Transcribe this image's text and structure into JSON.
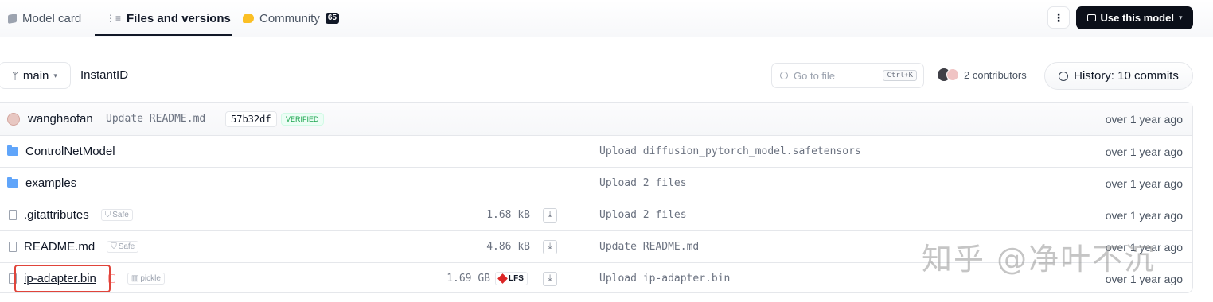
{
  "tabs": [
    {
      "label": "Model card"
    },
    {
      "label": "Files and versions"
    },
    {
      "label": "Community",
      "badge": "65"
    }
  ],
  "actions": {
    "kebab": "⋮",
    "use_model": "Use this model"
  },
  "toolbar": {
    "branch": "main",
    "repo": "InstantID",
    "search_placeholder": "Go to file",
    "search_shortcut": "Ctrl+K",
    "contributors": "2 contributors",
    "history": "History: 10 commits"
  },
  "last_commit": {
    "author": "wanghaofan",
    "message": "Update README.md",
    "hash": "57b32df",
    "status": "VERIFIED",
    "time": "over 1 year ago"
  },
  "files": [
    {
      "name": "ControlNetModel",
      "type": "folder",
      "message": "Upload diffusion_pytorch_model.safetensors",
      "time": "over 1 year ago"
    },
    {
      "name": "examples",
      "type": "folder",
      "message": "Upload 2 files",
      "time": "over 1 year ago"
    },
    {
      "name": ".gitattributes",
      "type": "file",
      "tag": "Safe",
      "size": "1.68 kB",
      "message": "Upload 2 files",
      "time": "over 1 year ago"
    },
    {
      "name": "README.md",
      "type": "file",
      "tag": "Safe",
      "size": "4.86 kB",
      "message": "Update README.md",
      "time": "over 1 year ago"
    },
    {
      "name": "ip-adapter.bin",
      "type": "file",
      "tag": "pickle",
      "size": "1.69 GB",
      "lfs": "LFS",
      "message": "Upload ip-adapter.bin",
      "time": "over 1 year ago"
    }
  ],
  "watermark": "知乎 @净叶不沉",
  "colors": {
    "accent": "#0b0f19",
    "folder": "#60a5fa",
    "verified": "#16a34a",
    "highlight": "#e0443a"
  }
}
